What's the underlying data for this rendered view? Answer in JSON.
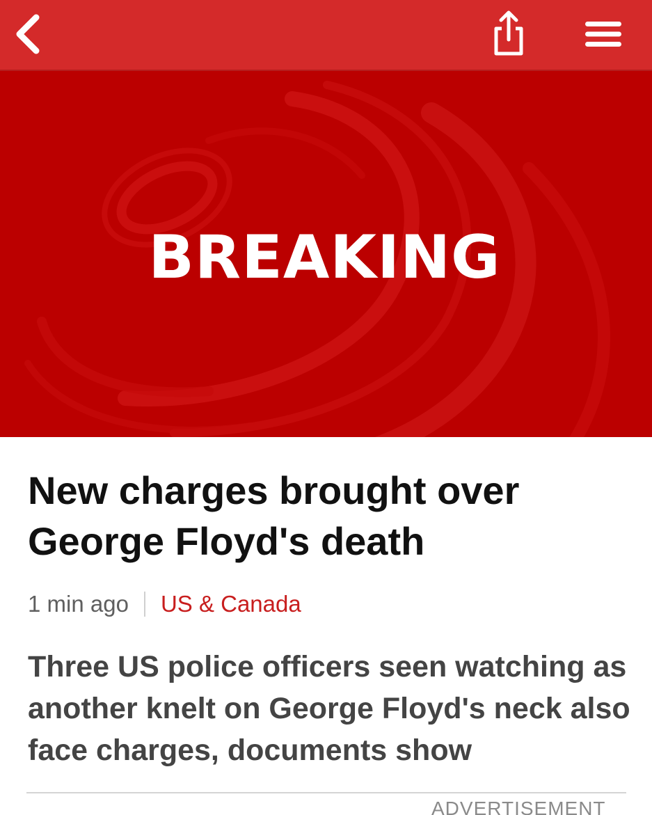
{
  "topbar": {
    "background_color": "#d42a2a",
    "back_icon": "chevron-left-icon",
    "share_icon": "share-icon",
    "menu_icon": "hamburger-menu-icon"
  },
  "hero": {
    "label": "BREAKING",
    "background_color": "#bb0000"
  },
  "article": {
    "headline": "New charges brought over George Floyd's death",
    "timestamp": "1 min ago",
    "section": "US & Canada",
    "section_color": "#c81e1e",
    "summary": "Three US police officers seen watching as another knelt on George Floyd's neck also face charges, documents show"
  },
  "advertisement": {
    "label": "ADVERTISEMENT"
  }
}
